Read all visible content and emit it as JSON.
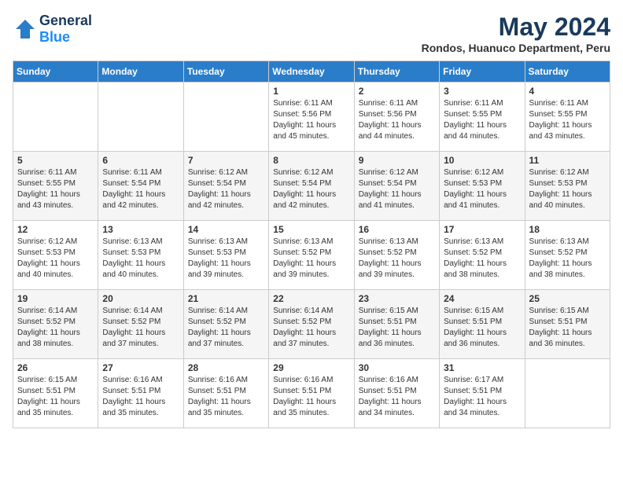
{
  "header": {
    "logo_general": "General",
    "logo_blue": "Blue",
    "month_year": "May 2024",
    "location": "Rondos, Huanuco Department, Peru"
  },
  "days_of_week": [
    "Sunday",
    "Monday",
    "Tuesday",
    "Wednesday",
    "Thursday",
    "Friday",
    "Saturday"
  ],
  "weeks": [
    [
      {
        "day": "",
        "sunrise": "",
        "sunset": "",
        "daylight": ""
      },
      {
        "day": "",
        "sunrise": "",
        "sunset": "",
        "daylight": ""
      },
      {
        "day": "",
        "sunrise": "",
        "sunset": "",
        "daylight": ""
      },
      {
        "day": "1",
        "sunrise": "Sunrise: 6:11 AM",
        "sunset": "Sunset: 5:56 PM",
        "daylight": "Daylight: 11 hours and 45 minutes."
      },
      {
        "day": "2",
        "sunrise": "Sunrise: 6:11 AM",
        "sunset": "Sunset: 5:56 PM",
        "daylight": "Daylight: 11 hours and 44 minutes."
      },
      {
        "day": "3",
        "sunrise": "Sunrise: 6:11 AM",
        "sunset": "Sunset: 5:55 PM",
        "daylight": "Daylight: 11 hours and 44 minutes."
      },
      {
        "day": "4",
        "sunrise": "Sunrise: 6:11 AM",
        "sunset": "Sunset: 5:55 PM",
        "daylight": "Daylight: 11 hours and 43 minutes."
      }
    ],
    [
      {
        "day": "5",
        "sunrise": "Sunrise: 6:11 AM",
        "sunset": "Sunset: 5:55 PM",
        "daylight": "Daylight: 11 hours and 43 minutes."
      },
      {
        "day": "6",
        "sunrise": "Sunrise: 6:11 AM",
        "sunset": "Sunset: 5:54 PM",
        "daylight": "Daylight: 11 hours and 42 minutes."
      },
      {
        "day": "7",
        "sunrise": "Sunrise: 6:12 AM",
        "sunset": "Sunset: 5:54 PM",
        "daylight": "Daylight: 11 hours and 42 minutes."
      },
      {
        "day": "8",
        "sunrise": "Sunrise: 6:12 AM",
        "sunset": "Sunset: 5:54 PM",
        "daylight": "Daylight: 11 hours and 42 minutes."
      },
      {
        "day": "9",
        "sunrise": "Sunrise: 6:12 AM",
        "sunset": "Sunset: 5:54 PM",
        "daylight": "Daylight: 11 hours and 41 minutes."
      },
      {
        "day": "10",
        "sunrise": "Sunrise: 6:12 AM",
        "sunset": "Sunset: 5:53 PM",
        "daylight": "Daylight: 11 hours and 41 minutes."
      },
      {
        "day": "11",
        "sunrise": "Sunrise: 6:12 AM",
        "sunset": "Sunset: 5:53 PM",
        "daylight": "Daylight: 11 hours and 40 minutes."
      }
    ],
    [
      {
        "day": "12",
        "sunrise": "Sunrise: 6:12 AM",
        "sunset": "Sunset: 5:53 PM",
        "daylight": "Daylight: 11 hours and 40 minutes."
      },
      {
        "day": "13",
        "sunrise": "Sunrise: 6:13 AM",
        "sunset": "Sunset: 5:53 PM",
        "daylight": "Daylight: 11 hours and 40 minutes."
      },
      {
        "day": "14",
        "sunrise": "Sunrise: 6:13 AM",
        "sunset": "Sunset: 5:53 PM",
        "daylight": "Daylight: 11 hours and 39 minutes."
      },
      {
        "day": "15",
        "sunrise": "Sunrise: 6:13 AM",
        "sunset": "Sunset: 5:52 PM",
        "daylight": "Daylight: 11 hours and 39 minutes."
      },
      {
        "day": "16",
        "sunrise": "Sunrise: 6:13 AM",
        "sunset": "Sunset: 5:52 PM",
        "daylight": "Daylight: 11 hours and 39 minutes."
      },
      {
        "day": "17",
        "sunrise": "Sunrise: 6:13 AM",
        "sunset": "Sunset: 5:52 PM",
        "daylight": "Daylight: 11 hours and 38 minutes."
      },
      {
        "day": "18",
        "sunrise": "Sunrise: 6:13 AM",
        "sunset": "Sunset: 5:52 PM",
        "daylight": "Daylight: 11 hours and 38 minutes."
      }
    ],
    [
      {
        "day": "19",
        "sunrise": "Sunrise: 6:14 AM",
        "sunset": "Sunset: 5:52 PM",
        "daylight": "Daylight: 11 hours and 38 minutes."
      },
      {
        "day": "20",
        "sunrise": "Sunrise: 6:14 AM",
        "sunset": "Sunset: 5:52 PM",
        "daylight": "Daylight: 11 hours and 37 minutes."
      },
      {
        "day": "21",
        "sunrise": "Sunrise: 6:14 AM",
        "sunset": "Sunset: 5:52 PM",
        "daylight": "Daylight: 11 hours and 37 minutes."
      },
      {
        "day": "22",
        "sunrise": "Sunrise: 6:14 AM",
        "sunset": "Sunset: 5:52 PM",
        "daylight": "Daylight: 11 hours and 37 minutes."
      },
      {
        "day": "23",
        "sunrise": "Sunrise: 6:15 AM",
        "sunset": "Sunset: 5:51 PM",
        "daylight": "Daylight: 11 hours and 36 minutes."
      },
      {
        "day": "24",
        "sunrise": "Sunrise: 6:15 AM",
        "sunset": "Sunset: 5:51 PM",
        "daylight": "Daylight: 11 hours and 36 minutes."
      },
      {
        "day": "25",
        "sunrise": "Sunrise: 6:15 AM",
        "sunset": "Sunset: 5:51 PM",
        "daylight": "Daylight: 11 hours and 36 minutes."
      }
    ],
    [
      {
        "day": "26",
        "sunrise": "Sunrise: 6:15 AM",
        "sunset": "Sunset: 5:51 PM",
        "daylight": "Daylight: 11 hours and 35 minutes."
      },
      {
        "day": "27",
        "sunrise": "Sunrise: 6:16 AM",
        "sunset": "Sunset: 5:51 PM",
        "daylight": "Daylight: 11 hours and 35 minutes."
      },
      {
        "day": "28",
        "sunrise": "Sunrise: 6:16 AM",
        "sunset": "Sunset: 5:51 PM",
        "daylight": "Daylight: 11 hours and 35 minutes."
      },
      {
        "day": "29",
        "sunrise": "Sunrise: 6:16 AM",
        "sunset": "Sunset: 5:51 PM",
        "daylight": "Daylight: 11 hours and 35 minutes."
      },
      {
        "day": "30",
        "sunrise": "Sunrise: 6:16 AM",
        "sunset": "Sunset: 5:51 PM",
        "daylight": "Daylight: 11 hours and 34 minutes."
      },
      {
        "day": "31",
        "sunrise": "Sunrise: 6:17 AM",
        "sunset": "Sunset: 5:51 PM",
        "daylight": "Daylight: 11 hours and 34 minutes."
      },
      {
        "day": "",
        "sunrise": "",
        "sunset": "",
        "daylight": ""
      }
    ]
  ]
}
